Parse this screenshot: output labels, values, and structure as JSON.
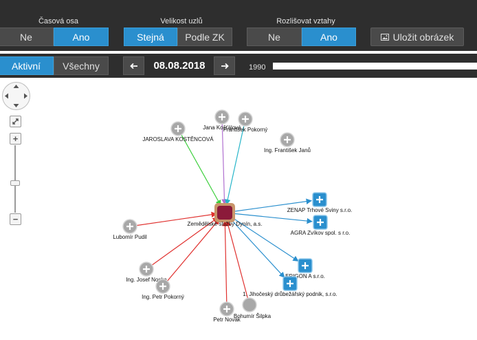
{
  "toolbar": {
    "timeline_group": {
      "label": "Časová osa",
      "options": [
        "Ne",
        "Ano"
      ],
      "active": 1
    },
    "node_size_group": {
      "label": "Velikost uzlů",
      "options": [
        "Stejná",
        "Podle ZK"
      ],
      "active": 0
    },
    "relations_group": {
      "label": "Rozlišovat vztahy",
      "options": [
        "Ne",
        "Ano"
      ],
      "active": 1
    },
    "save_label": "Uložit obrázek",
    "save_icon": "image-icon"
  },
  "subbar": {
    "filter_tabs": [
      "Aktivní",
      "Všechny"
    ],
    "filter_active": 0,
    "date": "08.08.2018",
    "prev_icon": "arrow-left-icon",
    "next_icon": "arrow-right-icon",
    "timeline_start_year": "1990"
  },
  "controls": {
    "pan_icon": "pan-control-icon",
    "fullscreen_icon": "expand-icon",
    "zoom_in": "+",
    "zoom_out": "−"
  },
  "colors": {
    "accent": "#2a8fce",
    "toolbar_bg": "#2e2e2e",
    "center_node": "#8b1a3a",
    "center_halo": "#c8956a",
    "person_node": "#a8a8a8",
    "company_node": "#2a8fce",
    "edge_person": "#e0302e",
    "edge_company": "#2a8fce",
    "edge_green": "#3ccf3c",
    "edge_purple": "#b070d0",
    "edge_teal": "#26b5c9"
  },
  "graph": {
    "center": {
      "label": "Zemědělské služby Dynín, a.s."
    },
    "nodes": [
      {
        "id": "kostencova",
        "label": "JAROSLAVA KOSTĚNCOVÁ",
        "kind": "person",
        "edge": "green"
      },
      {
        "id": "kostalova",
        "label": "Jana Košťálová",
        "kind": "person",
        "edge": "purple"
      },
      {
        "id": "pokorny-f",
        "label": "František Pokorný",
        "kind": "person",
        "edge": "teal"
      },
      {
        "id": "jano",
        "label": "Ing. František Janů",
        "kind": "person",
        "edge": "none"
      },
      {
        "id": "zenap",
        "label": "ZENAP Trhové Sviny s.r.o.",
        "kind": "company",
        "edge": "company"
      },
      {
        "id": "agra",
        "label": "AGRA Zvíkov spol. s r.o.",
        "kind": "company",
        "edge": "company"
      },
      {
        "id": "erigon",
        "label": "ERIGON A s.r.o.",
        "kind": "company",
        "edge": "company"
      },
      {
        "id": "jihocesky",
        "label": "1. Jihočeský drůbežářský podnik, s.r.o.",
        "kind": "company",
        "edge": "company"
      },
      {
        "id": "pudil",
        "label": "Lubomír Pudil",
        "kind": "person",
        "edge": "person"
      },
      {
        "id": "noska",
        "label": "Ing. Josef Noska",
        "kind": "person",
        "edge": "person"
      },
      {
        "id": "pokorny-p",
        "label": "Ing. Petr Pokorný",
        "kind": "person",
        "edge": "person"
      },
      {
        "id": "novak",
        "label": "Petr Novák",
        "kind": "person",
        "edge": "person"
      },
      {
        "id": "silpka",
        "label": "Bohumír Šilpka",
        "kind": "person-plain",
        "edge": "person"
      }
    ]
  }
}
